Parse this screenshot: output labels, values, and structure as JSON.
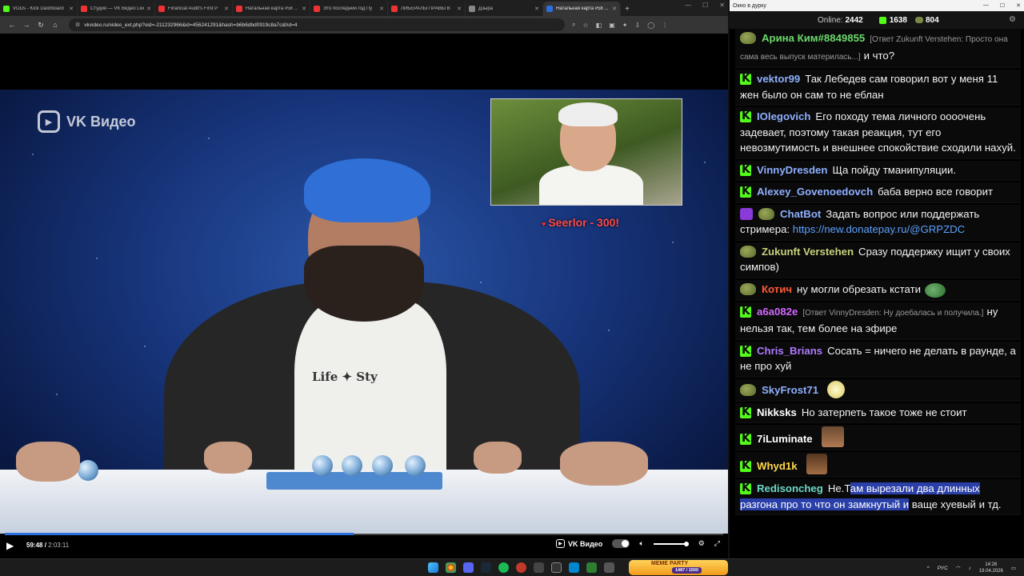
{
  "browser": {
    "tabs": [
      {
        "title": "VODs - Kick Dashboard",
        "color": "#53fc18",
        "active": false
      },
      {
        "title": "Студия — VK Видео Live",
        "color": "#e33",
        "active": false
      },
      {
        "title": "Financial Audit's First P",
        "color": "#e33",
        "active": false
      },
      {
        "title": "Натальная карта #58 ...",
        "color": "#e33",
        "active": false
      },
      {
        "title": "Это последний год Пу",
        "color": "#e33",
        "active": false
      },
      {
        "title": "ЛИБЕРАЛЫ ПРАВЫ В",
        "color": "#e33",
        "active": false
      },
      {
        "title": "Дзыра",
        "color": "#888",
        "active": false
      },
      {
        "title": "Натальная карта #58 ...",
        "color": "#2d6fdd",
        "active": true
      }
    ],
    "new_tab": "+",
    "url": "vkvideo.ru/video_ext.php?oid=-211232966&id=456241291&hash=b6b6dbd0919c8a7c&hd=4"
  },
  "video": {
    "watermark": "VK Видео",
    "donation": "Seerlor - 300!",
    "shirt_text": "Life ✦ Sty",
    "current_time": "59:48",
    "duration": "2:03:11",
    "progress": 0.4857,
    "brand_label": "VK Видео"
  },
  "chat": {
    "window_title": "Окно в дурку",
    "online_label": "Online:",
    "online_count": "2442",
    "kick_count": "1638",
    "pepe_count": "804",
    "messages": [
      {
        "badges": [
          "pepe"
        ],
        "user": "Арина Ким#8849855",
        "color": "#6cd96c",
        "reply": "[Ответ Zukunft Verstehen: Просто она сама весь выпуск материлась...]",
        "text": "и что?",
        "emote": ""
      },
      {
        "badges": [
          "kick"
        ],
        "user": "vektor99",
        "color": "#8fb0ff",
        "reply": "",
        "text": "Так Лебедев сам говорил вот у меня 11 жен было он сам то не еблан",
        "emote": ""
      },
      {
        "badges": [
          "kick"
        ],
        "user": "IOlegovich",
        "color": "#8fb0ff",
        "reply": "",
        "text": "Его походу тема личного оооочень задевает, поэтому такая реакция, тут его невозмутимость и внешнее спокойствие сходили нахуй.",
        "emote": ""
      },
      {
        "badges": [
          "kick"
        ],
        "user": "VinnyDresden",
        "color": "#8fb0ff",
        "reply": "",
        "text": "Ща пойду тманипуляции.",
        "emote": ""
      },
      {
        "badges": [
          "kick"
        ],
        "user": "Alexey_Govenoedovch",
        "color": "#8fb0ff",
        "reply": "",
        "text": "баба верно все говорит",
        "emote": ""
      },
      {
        "badges": [
          "bot",
          "pepe"
        ],
        "user": "ChatBot",
        "color": "#8fb0ff",
        "reply": "",
        "text": "Задать вопрос или поддержать стримера: ",
        "link": "https://new.donatepay.ru/@GRPZDC",
        "emote": ""
      },
      {
        "badges": [
          "pepe"
        ],
        "user": "Zukunft Verstehen",
        "color": "#c8d27a",
        "reply": "",
        "text": "Сразу поддержку ищит у своих симпов)",
        "emote": ""
      },
      {
        "badges": [
          "pepe"
        ],
        "user": "Котич",
        "color": "#ff5a3a",
        "reply": "",
        "text": "ну могли обрезать кстати",
        "emote": "pepe"
      },
      {
        "badges": [
          "kick"
        ],
        "user": "a6a082e",
        "color": "#d06aff",
        "reply": "[Ответ VinnyDresden: Ну доебалась и получила.]",
        "text": "ну нельзя так, тем более на эфире",
        "emote": ""
      },
      {
        "badges": [
          "kick"
        ],
        "user": "Chris_Brians",
        "color": "#b07aff",
        "reply": "",
        "text": "Сосать = ничего не делать в раунде, а не про хуй",
        "emote": ""
      },
      {
        "badges": [
          "pepe"
        ],
        "user": "SkyFrost71",
        "color": "#8fb0ff",
        "reply": "",
        "text": "",
        "emote": "troll"
      },
      {
        "badges": [
          "kick"
        ],
        "user": "Nikksks",
        "color": "#ffffff",
        "reply": "",
        "text": "Но затерпеть такое тоже не стоит",
        "emote": ""
      },
      {
        "badges": [
          "kick"
        ],
        "user": "7iLuminate",
        "color": "#ffffff",
        "reply": "",
        "text": "",
        "emote": "face1"
      },
      {
        "badges": [
          "kick"
        ],
        "user": "Whyd1k",
        "color": "#ffd84a",
        "reply": "",
        "text": "",
        "emote": "face2"
      },
      {
        "badges": [
          "kick"
        ],
        "user": "Redisoncheg",
        "color": "#6cd9c8",
        "reply": "",
        "text_plain": "Не.Т",
        "text_sel": "ам вырезали два длинных разгона про то что он замкнутый и",
        "text_after": " ваще хуевый и тд.",
        "emote": ""
      }
    ]
  },
  "taskbar": {
    "meme_party": "MEME PARTY",
    "meme_sub": "1487 / 1500",
    "lang": "РУС",
    "time": "14:26",
    "date": "19.04.2026"
  }
}
